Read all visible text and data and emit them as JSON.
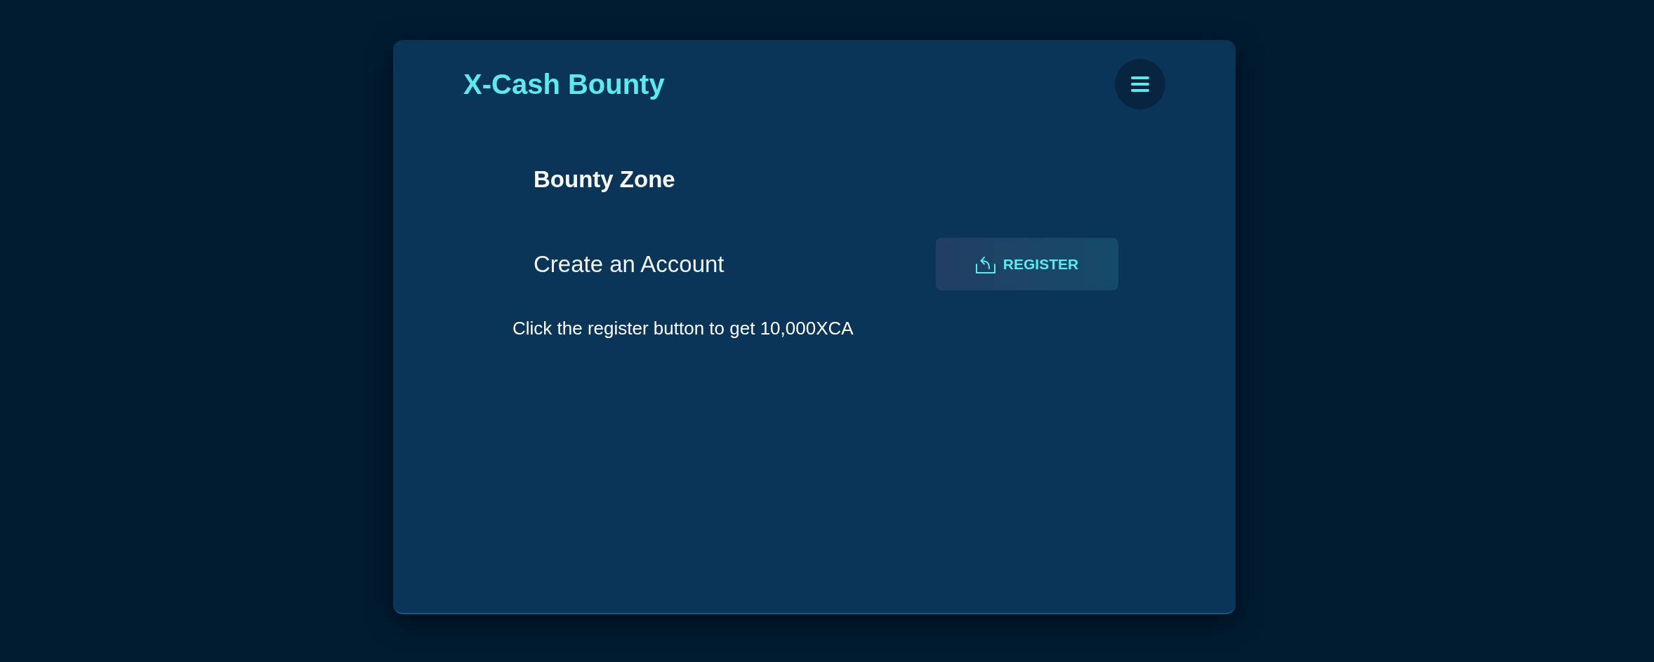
{
  "header": {
    "title": "X-Cash Bounty"
  },
  "section": {
    "heading": "Bounty Zone",
    "row": {
      "label": "Create an Account",
      "button": "REGISTER"
    },
    "note": "Click the register button to get 10,000XCA"
  }
}
